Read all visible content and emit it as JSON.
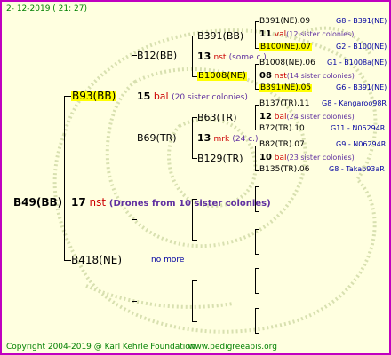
{
  "header": {
    "date": "2- 12-2019 ( 21: 27)"
  },
  "footer": {
    "copyright": "Copyright 2004-2019 @ Karl Kehrle Foundation",
    "site": "www.pedigreeapis.org"
  },
  "root": {
    "id": "B49(BB)",
    "num": "17",
    "race": "nst",
    "note": "(Drones from 10 sister colonies)"
  },
  "gen1": {
    "top": {
      "id": "B93(BB)",
      "num": "15",
      "race": "bal",
      "note": "(20 sister colonies)"
    },
    "bottom": {
      "id": "B418(NE)",
      "note": "no more"
    }
  },
  "gen2": {
    "a": {
      "id": "B12(BB)"
    },
    "b": {
      "id": "B69(TR)"
    }
  },
  "gen3": {
    "a1": {
      "id": "B391(BB)",
      "num": "13",
      "race": "nst",
      "note": "(some c.)"
    },
    "a2": {
      "id": "B1008(NE)"
    },
    "b1": {
      "id": "B63(TR)",
      "num": "13",
      "race": "mrk",
      "note": "(24 c.)"
    },
    "b2": {
      "id": "B129(TR)"
    }
  },
  "gen4": [
    {
      "id": "B391(NE).09",
      "ref": "G8 - B391(NE)"
    },
    {
      "num": "11",
      "race": "val",
      "note": "(12 sister colonies)"
    },
    {
      "id": "B100(NE).07",
      "ref": "G2 - B100(NE)"
    },
    {
      "id": "B1008(NE).06",
      "ref": "G1 - B1008a(NE)"
    },
    {
      "num": "08",
      "race": "nst",
      "note": "(14 sister colonies)"
    },
    {
      "id": "B391(NE).05",
      "ref": "G6 - B391(NE)"
    },
    {
      "id": "B137(TR).11",
      "ref": "G8 - Kangaroo98R"
    },
    {
      "num": "12",
      "race": "bal",
      "note": "(24 sister colonies)"
    },
    {
      "id": "B72(TR).10",
      "ref": "G11 - N06294R"
    },
    {
      "id": "B82(TR).07",
      "ref": "G9 - N06294R"
    },
    {
      "num": "10",
      "race": "bal",
      "note": "(23 sister colonies)"
    },
    {
      "id": "B135(TR).06",
      "ref": "G8 - Takab93aR"
    }
  ]
}
